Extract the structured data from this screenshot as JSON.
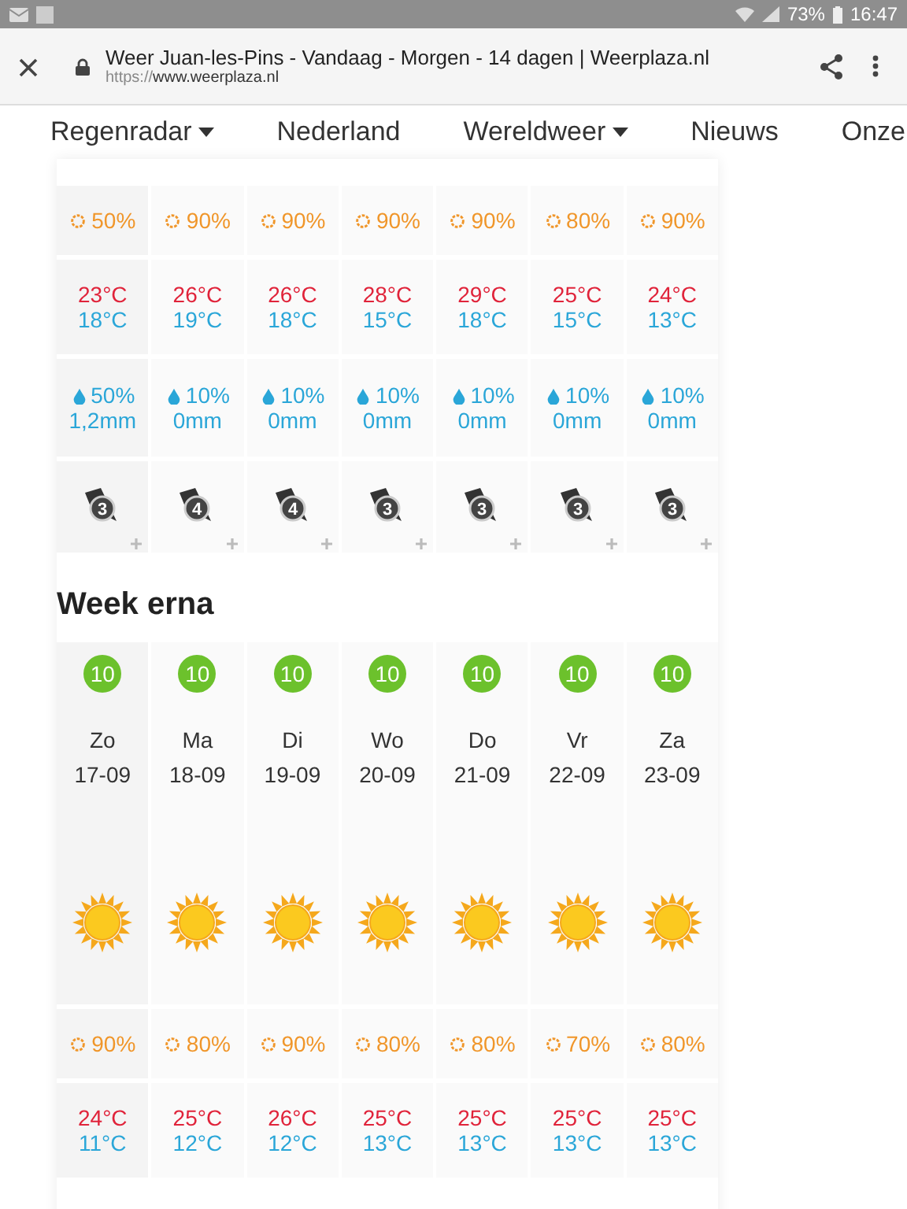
{
  "status_bar": {
    "battery": "73%",
    "time": "16:47"
  },
  "browser": {
    "title": "Weer Juan-les-Pins - Vandaag - Morgen - 14 dagen | Weerplaza.nl",
    "url_scheme": "https://",
    "url_host": "www.weerplaza.nl"
  },
  "nav": [
    {
      "label": "Regenradar",
      "dropdown": true
    },
    {
      "label": "Nederland",
      "dropdown": false
    },
    {
      "label": "Wereldweer",
      "dropdown": true
    },
    {
      "label": "Nieuws",
      "dropdown": false
    },
    {
      "label": "Onze",
      "dropdown": false
    }
  ],
  "week": {
    "days": [
      {
        "sun": "50%",
        "high": "23°C",
        "low": "18°C",
        "rain_chance": "50%",
        "rain": "1,2mm",
        "wind": "3"
      },
      {
        "sun": "90%",
        "high": "26°C",
        "low": "19°C",
        "rain_chance": "10%",
        "rain": "0mm",
        "wind": "4"
      },
      {
        "sun": "90%",
        "high": "26°C",
        "low": "18°C",
        "rain_chance": "10%",
        "rain": "0mm",
        "wind": "4"
      },
      {
        "sun": "90%",
        "high": "28°C",
        "low": "15°C",
        "rain_chance": "10%",
        "rain": "0mm",
        "wind": "3"
      },
      {
        "sun": "90%",
        "high": "29°C",
        "low": "18°C",
        "rain_chance": "10%",
        "rain": "0mm",
        "wind": "3"
      },
      {
        "sun": "80%",
        "high": "25°C",
        "low": "15°C",
        "rain_chance": "10%",
        "rain": "0mm",
        "wind": "3"
      },
      {
        "sun": "90%",
        "high": "24°C",
        "low": "13°C",
        "rain_chance": "10%",
        "rain": "0mm",
        "wind": "3"
      }
    ]
  },
  "next_week": {
    "title": "Week erna",
    "days": [
      {
        "score": "10",
        "day": "Zo",
        "date": "17-09",
        "sun": "90%",
        "high": "24°C",
        "low": "11°C"
      },
      {
        "score": "10",
        "day": "Ma",
        "date": "18-09",
        "sun": "80%",
        "high": "25°C",
        "low": "12°C"
      },
      {
        "score": "10",
        "day": "Di",
        "date": "19-09",
        "sun": "90%",
        "high": "26°C",
        "low": "12°C"
      },
      {
        "score": "10",
        "day": "Wo",
        "date": "20-09",
        "sun": "80%",
        "high": "25°C",
        "low": "13°C"
      },
      {
        "score": "10",
        "day": "Do",
        "date": "21-09",
        "sun": "80%",
        "high": "25°C",
        "low": "13°C"
      },
      {
        "score": "10",
        "day": "Vr",
        "date": "22-09",
        "sun": "70%",
        "high": "25°C",
        "low": "13°C"
      },
      {
        "score": "10",
        "day": "Za",
        "date": "23-09",
        "sun": "80%",
        "high": "25°C",
        "low": "13°C"
      }
    ]
  }
}
